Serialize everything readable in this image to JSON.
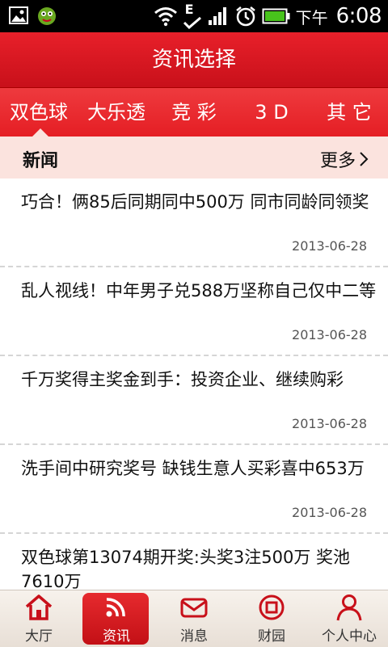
{
  "statusbar": {
    "ampm": "下午",
    "time": "6:08",
    "e_label": "E"
  },
  "title": "资讯选择",
  "tabs": [
    "双色球",
    "大乐透",
    "竞 彩",
    "3 D",
    "其 它"
  ],
  "news_header": {
    "title": "新闻",
    "more": "更多"
  },
  "news": [
    {
      "title": "巧合！俩85后同期同中500万 同市同龄同领奖",
      "date": "2013-06-28"
    },
    {
      "title": "乱人视线！中年男子兑588万坚称自己仅中二等",
      "date": "2013-06-28"
    },
    {
      "title": "千万奖得主奖金到手：投资企业、继续购彩",
      "date": "2013-06-28"
    },
    {
      "title": "洗手间中研究奖号 缺钱生意人买彩喜中653万",
      "date": "2013-06-28"
    },
    {
      "title": "双色球第13074期开奖:头奖3注500万 奖池7610万",
      "date": ""
    }
  ],
  "nav": [
    {
      "label": "大厅",
      "icon": "home-icon"
    },
    {
      "label": "资讯",
      "icon": "rss-icon"
    },
    {
      "label": "消息",
      "icon": "mail-icon"
    },
    {
      "label": "财园",
      "icon": "coin-icon"
    },
    {
      "label": "个人中心",
      "icon": "person-icon"
    }
  ],
  "colors": {
    "accent": "#e51e24",
    "header_bg": "#fbe3de",
    "nav_active": "#d11a20"
  }
}
